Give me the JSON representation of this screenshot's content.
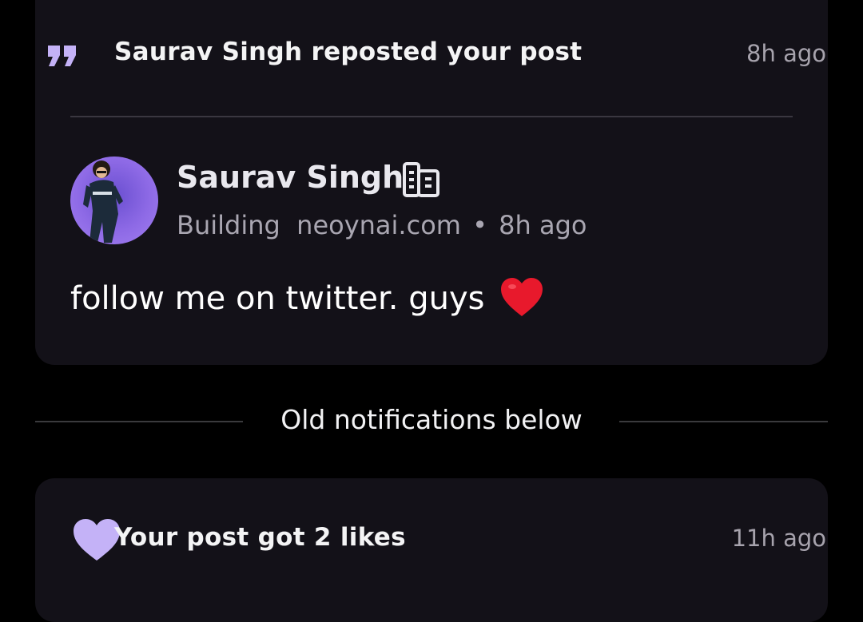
{
  "repost_notification": {
    "icon": "quote-icon",
    "text": "Saurav Singh reposted your post",
    "time": "8h ago",
    "post": {
      "author_name": "Saurav Singh",
      "author_badge_icon": "building-icon",
      "author_headline": "Building  neoynai.com",
      "separator": "•",
      "post_time": "8h ago",
      "body": "follow me on twitter. guys",
      "emoji": "red-heart-emoji"
    }
  },
  "separator": {
    "label": "Old notifications below"
  },
  "like_notification": {
    "icon": "heart-icon",
    "text": "Your post got 2 likes",
    "time": "11h ago"
  },
  "colors": {
    "background": "#000000",
    "card": "#131118",
    "accent": "#c4b2f7",
    "muted_text": "#a7a3ad",
    "emoji_red": "#e8192c"
  }
}
